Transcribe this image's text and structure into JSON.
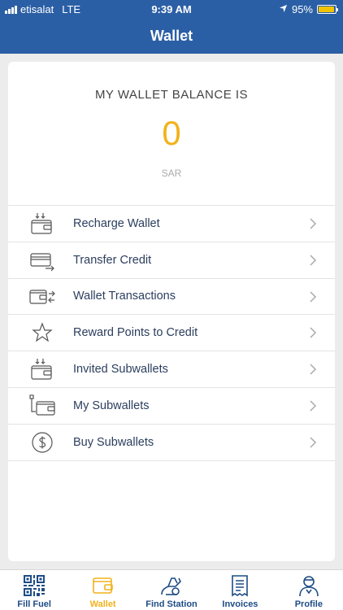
{
  "status_bar": {
    "carrier": "etisalat",
    "network": "LTE",
    "time": "9:39 AM",
    "battery_percent": "95%",
    "battery_level": 0.95
  },
  "header": {
    "title": "Wallet"
  },
  "balance": {
    "heading": "MY WALLET BALANCE IS",
    "amount": "0",
    "currency": "SAR"
  },
  "menu": {
    "items": [
      {
        "label": "Recharge Wallet",
        "icon": "wallet-download-icon"
      },
      {
        "label": "Transfer Credit",
        "icon": "card-transfer-icon"
      },
      {
        "label": "Wallet Transactions",
        "icon": "wallet-transactions-icon"
      },
      {
        "label": "Reward Points to Credit",
        "icon": "star-icon"
      },
      {
        "label": "Invited Subwallets",
        "icon": "wallet-download-icon"
      },
      {
        "label": "My Subwallets",
        "icon": "subwallets-icon"
      },
      {
        "label": "Buy Subwallets",
        "icon": "dollar-circle-icon"
      }
    ]
  },
  "tabbar": {
    "tabs": [
      {
        "label": "Fill Fuel",
        "icon": "qr-code-icon",
        "active": false
      },
      {
        "label": "Wallet",
        "icon": "wallet-icon",
        "active": true
      },
      {
        "label": "Find Station",
        "icon": "fuel-pump-icon",
        "active": false
      },
      {
        "label": "Invoices",
        "icon": "receipt-icon",
        "active": false
      },
      {
        "label": "Profile",
        "icon": "person-icon",
        "active": false
      }
    ]
  },
  "colors": {
    "primary": "#2b5fa5",
    "accent": "#f2b21c",
    "battery": "#f2c400",
    "text_dark": "#2b3e5e"
  }
}
